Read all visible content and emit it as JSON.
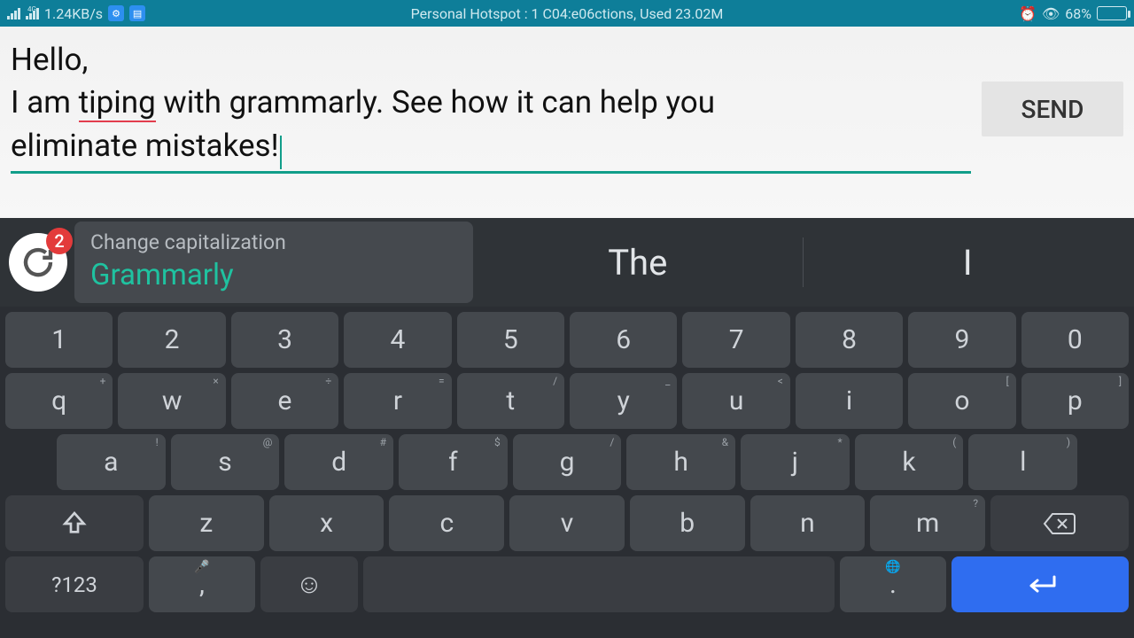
{
  "status": {
    "net_speed": "1.24KB/s",
    "center_text": "Personal Hotspot : 1 C04:e06ctions, Used 23.02M",
    "battery_pct": "68%",
    "battery_fill_pct": 68
  },
  "compose": {
    "line1": "Hello,",
    "line2_before": "I am ",
    "line2_error": "tiping",
    "line2_after": " with grammarly. See how it can help you",
    "line3": "eliminate mistakes!",
    "send_label": "SEND"
  },
  "suggestion": {
    "badge": "2",
    "title": "Change capitalization",
    "correction": "Grammarly",
    "option1": "The",
    "option2": "I"
  },
  "keyboard": {
    "numbers": [
      "1",
      "2",
      "3",
      "4",
      "5",
      "6",
      "7",
      "8",
      "9",
      "0"
    ],
    "row1": [
      "q",
      "w",
      "e",
      "r",
      "t",
      "y",
      "u",
      "i",
      "o",
      "p"
    ],
    "row1_sup": [
      "+",
      "×",
      "÷",
      "=",
      "/",
      "_",
      "<",
      "",
      "[",
      "]"
    ],
    "row2": [
      "a",
      "s",
      "d",
      "f",
      "g",
      "h",
      "j",
      "k",
      "l"
    ],
    "row2_sup": [
      "!",
      "@",
      "#",
      "$",
      "/",
      "&",
      "*",
      "(",
      ")"
    ],
    "row3": [
      "z",
      "x",
      "c",
      "v",
      "b",
      "n",
      "m"
    ],
    "row3_sup": [
      "",
      "",
      "",
      "",
      "",
      "",
      "?"
    ],
    "mic_sup": "🎤",
    "globe_sup": "🌐",
    "sym": "?123",
    "comma": ",",
    "dot": "."
  }
}
